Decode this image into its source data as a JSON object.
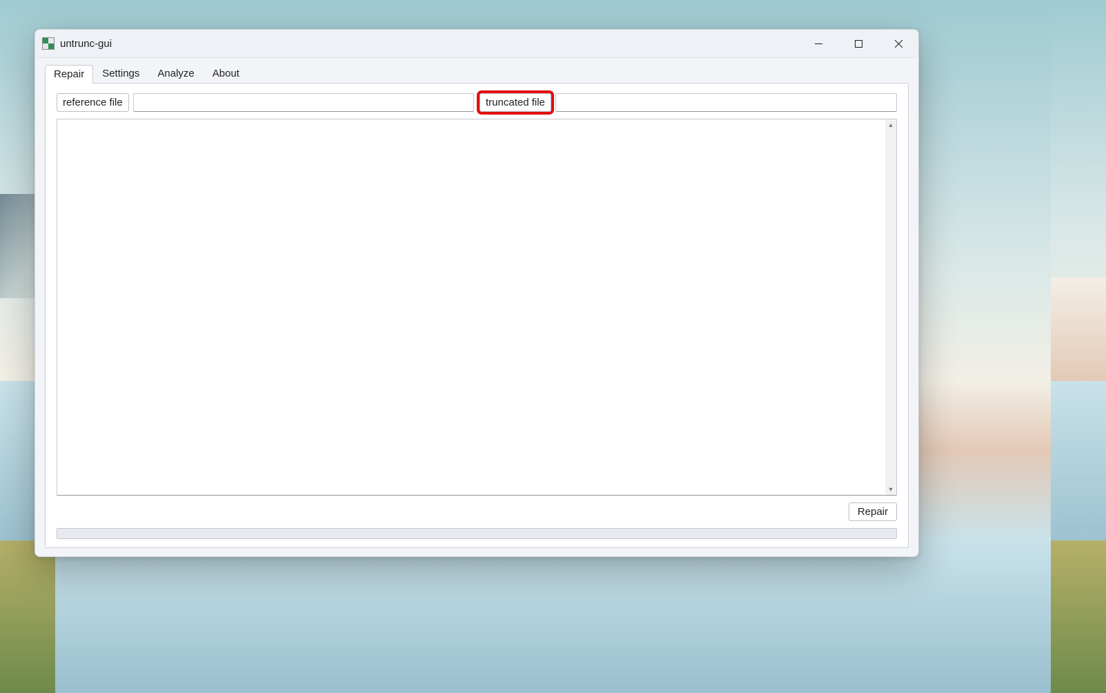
{
  "window": {
    "title": "untrunc-gui"
  },
  "tabs": {
    "repair": "Repair",
    "settings": "Settings",
    "analyze": "Analyze",
    "about": "About",
    "active": "repair"
  },
  "repair_tab": {
    "reference_button": "reference file",
    "reference_value": "",
    "truncated_button": "truncated file",
    "truncated_value": "",
    "log_text": "",
    "action_button": "Repair",
    "progress_percent": 0
  },
  "annotations": {
    "highlight_truncated_button": true
  }
}
